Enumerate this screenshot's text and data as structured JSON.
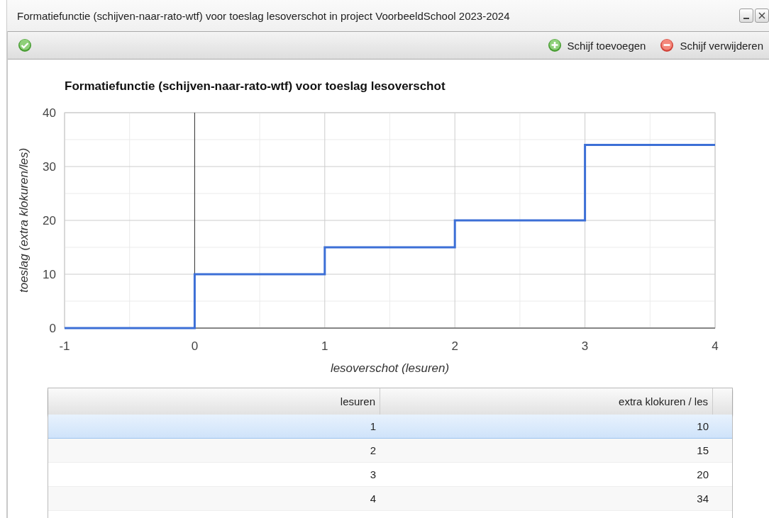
{
  "window": {
    "title": "Formatiefunctie (schijven-naar-rato-wtf) voor toeslag lesoverschot in project VoorbeeldSchool 2023-2024"
  },
  "toolbar": {
    "buttons": [
      {
        "label": "Schijf toevoegen",
        "kind": "add"
      },
      {
        "label": "Schijf verwijderen",
        "kind": "remove"
      }
    ]
  },
  "chart": {
    "chart_data": {
      "type": "line",
      "title": "Formatiefunctie (schijven-naar-rato-wtf) voor toeslag lesoverschot",
      "xlabel": "lesoverschot (lesuren)",
      "ylabel": "toeslag (extra klokuren/les)",
      "x": [
        -1,
        0,
        0,
        1,
        1,
        2,
        2,
        3,
        3,
        4
      ],
      "grid": true,
      "series": [
        {
          "color": "#3c6fd6",
          "values": [
            0,
            0,
            10,
            10,
            15,
            15,
            20,
            20,
            34,
            34
          ]
        }
      ],
      "xlim": [
        -1,
        4
      ],
      "ylim": [
        0,
        40
      ],
      "xticks": [
        -1,
        0,
        1,
        2,
        3,
        4
      ],
      "yticks": [
        0,
        10,
        20,
        30,
        40
      ]
    }
  },
  "table": {
    "columns": [
      "lesuren",
      "extra klokuren / les"
    ],
    "rows": [
      {
        "cells": [
          "1",
          "10"
        ],
        "selected": true
      },
      {
        "cells": [
          "2",
          "15"
        ],
        "selected": false
      },
      {
        "cells": [
          "3",
          "20"
        ],
        "selected": false
      },
      {
        "cells": [
          "4",
          "34"
        ],
        "selected": false
      }
    ]
  }
}
